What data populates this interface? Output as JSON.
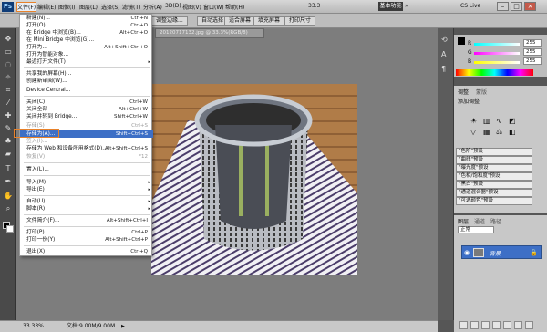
{
  "app": {
    "logo": "Ps"
  },
  "menubar": {
    "items": [
      "文件(F)",
      "编辑(E)",
      "图像(I)",
      "图层(L)",
      "选择(S)",
      "滤镜(T)",
      "分析(A)",
      "3D(D)",
      "视图(V)",
      "窗口(W)",
      "帮助(H)"
    ],
    "zoom": "33.3",
    "workspace": "基本功能",
    "chevron": "»",
    "cs_live": "CS Live",
    "win_min": "–",
    "win_max": "□",
    "win_close": "×"
  },
  "options_bar": {
    "buttons": [
      "调整边缘...",
      "自动选择",
      "适合屏幕",
      "填充屏幕",
      "打印尺寸"
    ]
  },
  "document": {
    "tab_label": "20120717132.jpg @ 33.3%(RGB/8)"
  },
  "status": {
    "zoom": "33.33%",
    "doc_info": "文档:9.00M/9.00M"
  },
  "file_menu": {
    "items": [
      {
        "label": "新建(N)...",
        "shortcut": "Ctrl+N"
      },
      {
        "label": "打开(O)...",
        "shortcut": "Ctrl+O"
      },
      {
        "label": "在 Bridge 中浏览(B)...",
        "shortcut": "Alt+Ctrl+O"
      },
      {
        "label": "在 Mini Bridge 中浏览(G)...",
        "shortcut": ""
      },
      {
        "label": "打开为...",
        "shortcut": "Alt+Shift+Ctrl+O"
      },
      {
        "label": "打开为智能对象...",
        "shortcut": ""
      },
      {
        "label": "最近打开文件(T)",
        "shortcut": ""
      },
      {
        "label": "共享我的屏幕(H)...",
        "shortcut": ""
      },
      {
        "label": "创建新审阅(W)...",
        "shortcut": ""
      },
      {
        "label": "Device Central...",
        "shortcut": ""
      },
      {
        "label": "关闭(C)",
        "shortcut": "Ctrl+W"
      },
      {
        "label": "关闭全部",
        "shortcut": "Alt+Ctrl+W"
      },
      {
        "label": "关闭并转到 Bridge...",
        "shortcut": "Shift+Ctrl+W"
      },
      {
        "label": "存储(S)",
        "shortcut": "Ctrl+S"
      },
      {
        "label": "存储为(A)...",
        "shortcut": "Shift+Ctrl+S"
      },
      {
        "label": "签入(I)...",
        "shortcut": ""
      },
      {
        "label": "存储为 Web 和设备所用格式(D)...",
        "shortcut": "Alt+Shift+Ctrl+S"
      },
      {
        "label": "恢复(V)",
        "shortcut": "F12"
      },
      {
        "label": "置入(L)...",
        "shortcut": ""
      },
      {
        "label": "导入(M)",
        "shortcut": ""
      },
      {
        "label": "导出(E)",
        "shortcut": ""
      },
      {
        "label": "自动(U)",
        "shortcut": ""
      },
      {
        "label": "脚本(R)",
        "shortcut": ""
      },
      {
        "label": "文件简介(F)...",
        "shortcut": "Alt+Shift+Ctrl+I"
      },
      {
        "label": "打印(P)...",
        "shortcut": "Ctrl+P"
      },
      {
        "label": "打印一份(Y)",
        "shortcut": "Alt+Shift+Ctrl+P"
      },
      {
        "label": "退出(X)",
        "shortcut": "Ctrl+Q"
      }
    ],
    "submenu_arrow": "▸"
  },
  "panels": {
    "color": {
      "r_label": "R",
      "g_label": "G",
      "b_label": "B",
      "r_value": "255",
      "g_value": "255",
      "b_value": "255"
    },
    "adjustments": {
      "tab": "调整",
      "tab2": "蒙版",
      "title": "添加调整",
      "presets": [
        "\"色阶\"预设",
        "\"曲线\"预设",
        "\"曝光度\"预设",
        "\"色相/饱和度\"预设",
        "\"黑白\"预设",
        "\"通道混合器\"预设",
        "\"可选颜色\"预设"
      ]
    },
    "layers": {
      "tab": "图层",
      "tab2": "通道",
      "tab3": "路径",
      "blend_mode": "正常",
      "layer_name": "背景"
    }
  },
  "colors": {
    "accent_highlight": "#3d6fc6",
    "annotation_box": "#e8822a"
  }
}
